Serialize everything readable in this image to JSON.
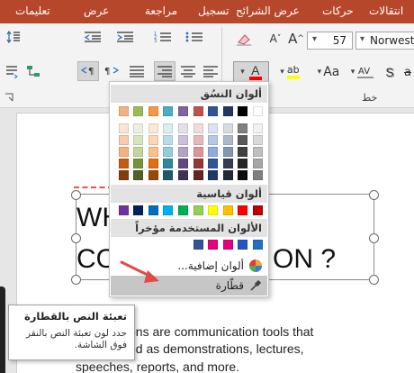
{
  "ribbon_tabs": [
    {
      "label": "انتقالات"
    },
    {
      "label": "حركات"
    },
    {
      "label": "عرض الشرائح"
    },
    {
      "label": "تسجيل"
    },
    {
      "label": "مراجعة"
    },
    {
      "label": "عرض"
    },
    {
      "label": "تعليمات"
    }
  ],
  "font": {
    "size_value": "57",
    "name_value": "Norweste",
    "group_label": "خط"
  },
  "slide": {
    "title_line1": "WH",
    "title_line2_left": "CO",
    "title_line2_right": "ON ?",
    "body_lines": [
      "ons are communication tools that",
      "ed as demonstrations, lectures,",
      "speeches, reports, and more."
    ]
  },
  "color_menu": {
    "theme_colors_label": "ألوان النسُق",
    "standard_colors_label": "ألوان قياسية",
    "recent_colors_label": "الألوان المستخدمة مؤخراً",
    "more_colors_label": "ألوان إضافية...",
    "eyedropper_label": "قطّارة",
    "theme_top_row": [
      "#ffffff",
      "#000000",
      "#1f3864",
      "#2f5597",
      "#c0504d",
      "#8064a2",
      "#4bacc6",
      "#f79646",
      "#9bbb59",
      "#f4b183"
    ],
    "theme_shade_columns": [
      [
        "#f2f2f2",
        "#d9d9d9",
        "#bfbfbf",
        "#a6a6a6",
        "#808080"
      ],
      [
        "#808080",
        "#595959",
        "#404040",
        "#262626",
        "#0d0d0d"
      ],
      [
        "#d6dce5",
        "#adb9ca",
        "#8497b0",
        "#333f50",
        "#222a35"
      ],
      [
        "#dae3f3",
        "#b4c7e7",
        "#8faadc",
        "#2f5597",
        "#1f3864"
      ],
      [
        "#f2dcdb",
        "#e6b9b8",
        "#d99694",
        "#953735",
        "#632523"
      ],
      [
        "#e4dfec",
        "#ccc1da",
        "#b3a2c7",
        "#604a7b",
        "#403152"
      ],
      [
        "#dbeef4",
        "#b7dde8",
        "#93cddd",
        "#31859c",
        "#205867"
      ],
      [
        "#fde9d9",
        "#fcd5b5",
        "#fac090",
        "#e46c0a",
        "#984807"
      ],
      [
        "#ebf1de",
        "#d7e4bd",
        "#c3d69b",
        "#77933c",
        "#4f6228"
      ],
      [
        "#fbe5d6",
        "#f8cbad",
        "#f4b183",
        "#c55a11",
        "#843c0c"
      ]
    ],
    "standard_colors": [
      "#c00000",
      "#ff0000",
      "#ffc000",
      "#ffff00",
      "#92d050",
      "#00b050",
      "#00b0f0",
      "#0070c0",
      "#002060",
      "#7030a0"
    ],
    "recent_colors": [
      "#1f6fc6",
      "#2554c7",
      "#e6007e",
      "#e6007e",
      "#2f5597"
    ]
  },
  "tooltip": {
    "title": "تعبئة النص بالقطارة",
    "body": "حدد لون تعبئة النص بالنقر فوق الشاشة."
  },
  "colors": {
    "ribbon_accent": "#b7472a",
    "font_color_red": "#ff0000",
    "highlight_yellow": "#ffff00",
    "arrow_red": "#e04b4b"
  }
}
